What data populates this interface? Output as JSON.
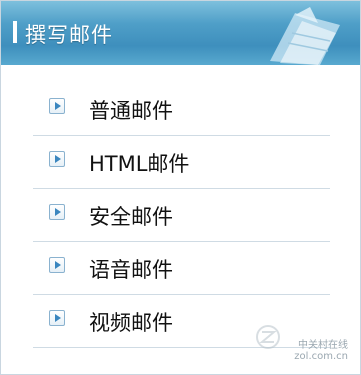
{
  "header": {
    "title": "撰写邮件"
  },
  "menu": {
    "items": [
      {
        "label": "普通邮件"
      },
      {
        "label": "HTML邮件"
      },
      {
        "label": "安全邮件"
      },
      {
        "label": "语音邮件"
      },
      {
        "label": "视频邮件"
      }
    ]
  },
  "watermark": {
    "line1": "中关村在线",
    "line2": "zol.com.cn"
  },
  "colors": {
    "header_blue": "#4f9fc8",
    "bullet_arrow": "#3a86bf",
    "divider": "#cfdbe4"
  }
}
